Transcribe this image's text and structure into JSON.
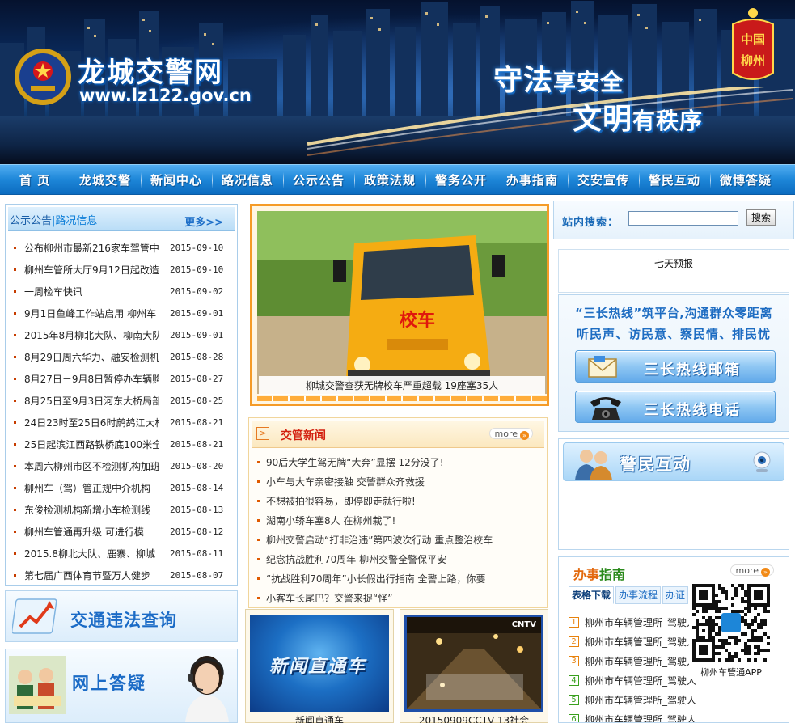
{
  "header": {
    "site_title": "龙城交警网",
    "site_url": "www.lz122.gov.cn",
    "slogan_1_big": "守法",
    "slogan_1_small": "享安全",
    "slogan_2_big": "文明",
    "slogan_2_small": "有秩序",
    "city_logo_text": "中国柳州"
  },
  "nav": {
    "items": [
      "首  页",
      "龙城交警",
      "新闻中心",
      "路况信息",
      "公示公告",
      "政策法规",
      "警务公开",
      "办事指南",
      "交安宣传",
      "警民互动",
      "微博答疑"
    ]
  },
  "notice": {
    "title_a": "公示公告",
    "title_sep": "|",
    "title_b": "路况信息",
    "more": "更多>>",
    "items": [
      {
        "title": "公布柳州市最新216家车驾管中",
        "date": "2015-09-10"
      },
      {
        "title": "柳州车管所大厅9月12日起改造",
        "date": "2015-09-10"
      },
      {
        "title": "一周检车快讯",
        "date": "2015-09-02"
      },
      {
        "title": "9月1日鱼峰工作站启用 柳州车",
        "date": "2015-09-01"
      },
      {
        "title": "2015年8月柳北大队、柳南大队",
        "date": "2015-09-01"
      },
      {
        "title": "8月29日周六华力、融安检测机",
        "date": "2015-08-28"
      },
      {
        "title": "8月27日－9月8日暂停办车辆购",
        "date": "2015-08-27"
      },
      {
        "title": "8月25日至9月3日河东大桥局部",
        "date": "2015-08-25"
      },
      {
        "title": "24日23时至25日6时鹧鸪江大桥",
        "date": "2015-08-21"
      },
      {
        "title": "25日起滨江西路铁桥底100米全",
        "date": "2015-08-21"
      },
      {
        "title": "本周六柳州市区不检测机构加班",
        "date": "2015-08-20"
      },
      {
        "title": "柳州车（驾）管正规中介机构",
        "date": "2015-08-14"
      },
      {
        "title": "东俊检测机构新增小车检测线",
        "date": "2015-08-13"
      },
      {
        "title": "柳州车管通再升级 可进行模",
        "date": "2015-08-12"
      },
      {
        "title": "2015.8柳北大队、鹿寨、柳城",
        "date": "2015-08-11"
      },
      {
        "title": "第七届广西体育节暨万人健步",
        "date": "2015-08-07"
      }
    ]
  },
  "left_banners": {
    "violation": "交通违法查询",
    "qa": "网上答疑"
  },
  "featured": {
    "bus_sign": "校车",
    "caption": "柳城交警查获无牌校车严重超载 19座塞35人"
  },
  "news": {
    "title": "交管新闻",
    "more": "more",
    "items": [
      "90后大学生驾无牌“大奔”显摆 12分没了!",
      "小车与大车亲密接触 交警群众齐救援",
      "不想被拍很容易，即停即走就行啦!",
      "湖南小轿车塞8人 在柳州栽了!",
      "柳州交警启动“打非治违”第四波次行动 重点整治校车",
      "纪念抗战胜利70周年 柳州交警全警保平安",
      "“抗战胜利70周年”小长假出行指南 全警上路，你要",
      "小客车长尾巴？交警来捉“怪”"
    ]
  },
  "videos": [
    {
      "thumb_text": "新闻直通车",
      "caption": "新闻直通车"
    },
    {
      "thumb_text": "CNTV",
      "caption": "20150909CCTV-13社会"
    }
  ],
  "search": {
    "label": "站内搜索：",
    "value": "",
    "button": "搜索"
  },
  "weather": {
    "title": "七天预报"
  },
  "hotline": {
    "line_1": "“三长热线”筑平台,沟通群众零距离",
    "line_2": "听民声、访民意、察民情、排民忧",
    "mail_label": "三长热线邮箱",
    "phone_label": "三长热线电话"
  },
  "interaction": {
    "label": "警民互动"
  },
  "guide": {
    "title_a": "办事",
    "title_b": "指南",
    "more": "more",
    "tabs": [
      "表格下载",
      "办事流程",
      "办证"
    ],
    "items": [
      {
        "num": "1",
        "text": "柳州市车辆管理所_驾驶人"
      },
      {
        "num": "2",
        "text": "柳州市车辆管理所_驾驶人"
      },
      {
        "num": "3",
        "text": "柳州市车辆管理所_驾驶人"
      },
      {
        "num": "4",
        "text": "柳州市车辆管理所_驾驶人"
      },
      {
        "num": "5",
        "text": "柳州市车辆管理所_驾驶人"
      },
      {
        "num": "6",
        "text": "柳州市车辆管理所_驾驶人"
      }
    ],
    "num_colors": [
      "#e8820c",
      "#e8820c",
      "#e8820c",
      "#3aa01e",
      "#3aa01e",
      "#3aa01e"
    ]
  },
  "qr": {
    "caption": "柳州车管通APP"
  },
  "colors": {
    "nav_blue": "#1d86d8",
    "accent_orange": "#f59b27",
    "news_red": "#d3200f",
    "link_blue": "#1b6bc6"
  }
}
